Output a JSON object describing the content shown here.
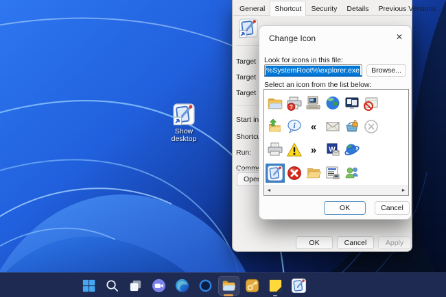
{
  "desktop": {
    "shortcut": {
      "label_line1": "Show",
      "label_line2": "desktop",
      "icon": "show-desktop"
    }
  },
  "properties_window": {
    "tabs": [
      {
        "label": "General",
        "active": false
      },
      {
        "label": "Shortcut",
        "active": true
      },
      {
        "label": "Security",
        "active": false
      },
      {
        "label": "Details",
        "active": false
      },
      {
        "label": "Previous Versions",
        "active": false
      }
    ],
    "left_labels": [
      "Target",
      "Target",
      "Target",
      "Start in",
      "Shortcut",
      "Run:",
      "Comment"
    ],
    "open_button_label": "Open Fi",
    "buttons": {
      "ok": "OK",
      "cancel": "Cancel",
      "apply": "Apply"
    }
  },
  "change_icon_dialog": {
    "title": "Change Icon",
    "close_glyph": "✕",
    "look_label": "Look for icons in this file:",
    "file_input": {
      "value": "%SystemRoot%\\explorer.exe",
      "selected": true
    },
    "browse_label": "Browse...",
    "select_label": "Select an icon from the list below:",
    "icon_grid": {
      "rows": [
        [
          "folder-closed",
          "printer-question",
          "computer-keyboard",
          "globe",
          "monitor-windows",
          "cardfile-blocked"
        ],
        [
          "folder-share",
          "info-bubble",
          "chevrons-left",
          "envelope",
          "basket-lock",
          "circle-cross"
        ],
        [
          "printer-document",
          "warning-triangle",
          "chevrons-right",
          "word-document",
          "globe-swoosh"
        ],
        [
          "show-desktop",
          "red-cross",
          "folder-open",
          "settings-list",
          "users"
        ]
      ],
      "selected": {
        "row": 3,
        "col": 0
      },
      "scroll_left_glyph": "◄",
      "scroll_right_glyph": "►"
    },
    "buttons": {
      "ok": "OK",
      "cancel": "Cancel"
    }
  },
  "taskbar": {
    "items": [
      {
        "name": "start-button",
        "icon": "start"
      },
      {
        "name": "search-button",
        "icon": "search"
      },
      {
        "name": "task-view-button",
        "icon": "task-view"
      },
      {
        "name": "chat-button",
        "icon": "chat"
      },
      {
        "name": "edge-button",
        "icon": "edge"
      },
      {
        "name": "ring-app-button",
        "icon": "ring-app"
      },
      {
        "name": "file-explorer-button",
        "icon": "explorer",
        "active": true,
        "indicator": "orange"
      },
      {
        "name": "keys-app-button",
        "icon": "keys-app"
      },
      {
        "name": "sticky-notes-button",
        "icon": "sticky-notes",
        "indicator": "gray"
      },
      {
        "name": "show-desktop-app-button",
        "icon": "show-desktop"
      }
    ]
  },
  "colors": {
    "selection_blue": "#3b7fc4",
    "input_selection": "#0078d7",
    "accent_underline": "#0067c0",
    "taskbar": "#1e2a52"
  }
}
